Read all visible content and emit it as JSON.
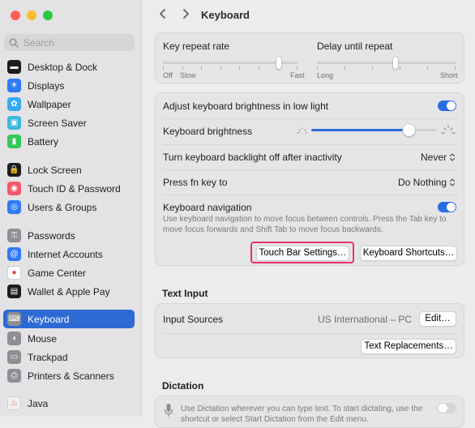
{
  "sidebar": {
    "search_placeholder": "Search",
    "items": [
      {
        "label": "Desktop & Dock",
        "icon": "dock-icon",
        "color": "#1c1c1e"
      },
      {
        "label": "Displays",
        "icon": "displays-icon",
        "color": "#2f7bf6"
      },
      {
        "label": "Wallpaper",
        "icon": "wallpaper-icon",
        "color": "#35aaf0"
      },
      {
        "label": "Screen Saver",
        "icon": "screen-saver-icon",
        "color": "#3ab8e0"
      },
      {
        "label": "Battery",
        "icon": "battery-icon",
        "color": "#34c759"
      },
      {
        "label": "Lock Screen",
        "icon": "lock-icon",
        "color": "#1c1c1e"
      },
      {
        "label": "Touch ID & Password",
        "icon": "fingerprint-icon",
        "color": "#f05a6b"
      },
      {
        "label": "Users & Groups",
        "icon": "users-icon",
        "color": "#2f7bf6"
      },
      {
        "label": "Passwords",
        "icon": "key-icon",
        "color": "#8e8e93"
      },
      {
        "label": "Internet Accounts",
        "icon": "at-icon",
        "color": "#2f7bf6"
      },
      {
        "label": "Game Center",
        "icon": "game-center-icon",
        "color": "#ffffff"
      },
      {
        "label": "Wallet & Apple Pay",
        "icon": "wallet-icon",
        "color": "#1c1c1e"
      },
      {
        "label": "Keyboard",
        "icon": "keyboard-icon",
        "color": "#8e8e93"
      },
      {
        "label": "Mouse",
        "icon": "mouse-icon",
        "color": "#8e8e93"
      },
      {
        "label": "Trackpad",
        "icon": "trackpad-icon",
        "color": "#8e8e93"
      },
      {
        "label": "Printers & Scanners",
        "icon": "printer-icon",
        "color": "#8e8e93"
      },
      {
        "label": "Java",
        "icon": "java-icon",
        "color": "#f0f0f0"
      }
    ]
  },
  "header": {
    "title": "Keyboard"
  },
  "repeat": {
    "key_repeat_label": "Key repeat rate",
    "delay_label": "Delay until repeat",
    "key_repeat_min": "Off",
    "key_repeat_slow": "Slow",
    "key_repeat_max": "Fast",
    "delay_min": "Long",
    "delay_max": "Short",
    "key_repeat_value": 0.86,
    "delay_value": 0.57
  },
  "settings": {
    "adjust_brightness_label": "Adjust keyboard brightness in low light",
    "adjust_brightness_on": true,
    "brightness_label": "Keyboard brightness",
    "brightness_value": 0.78,
    "backlight_off_label": "Turn keyboard backlight off after inactivity",
    "backlight_off_value": "Never",
    "fn_key_label": "Press fn key to",
    "fn_key_value": "Do Nothing",
    "nav_label": "Keyboard navigation",
    "nav_on": true,
    "nav_desc": "Use keyboard navigation to move focus between controls. Press the Tab key to move focus forwards and Shift Tab to move focus backwards.",
    "touch_bar_button": "Touch Bar Settings…",
    "shortcuts_button": "Keyboard Shortcuts…",
    "highlight_color": "#e4356a"
  },
  "text_input": {
    "section_title": "Text Input",
    "input_sources_label": "Input Sources",
    "input_sources_value": "US International – PC",
    "edit_button": "Edit…",
    "replacements_button": "Text Replacements…"
  },
  "dictation": {
    "section_title": "Dictation",
    "desc": "Use Dictation wherever you can type text. To start dictating, use the shortcut or select Start Dictation from the Edit menu.",
    "on": false
  }
}
